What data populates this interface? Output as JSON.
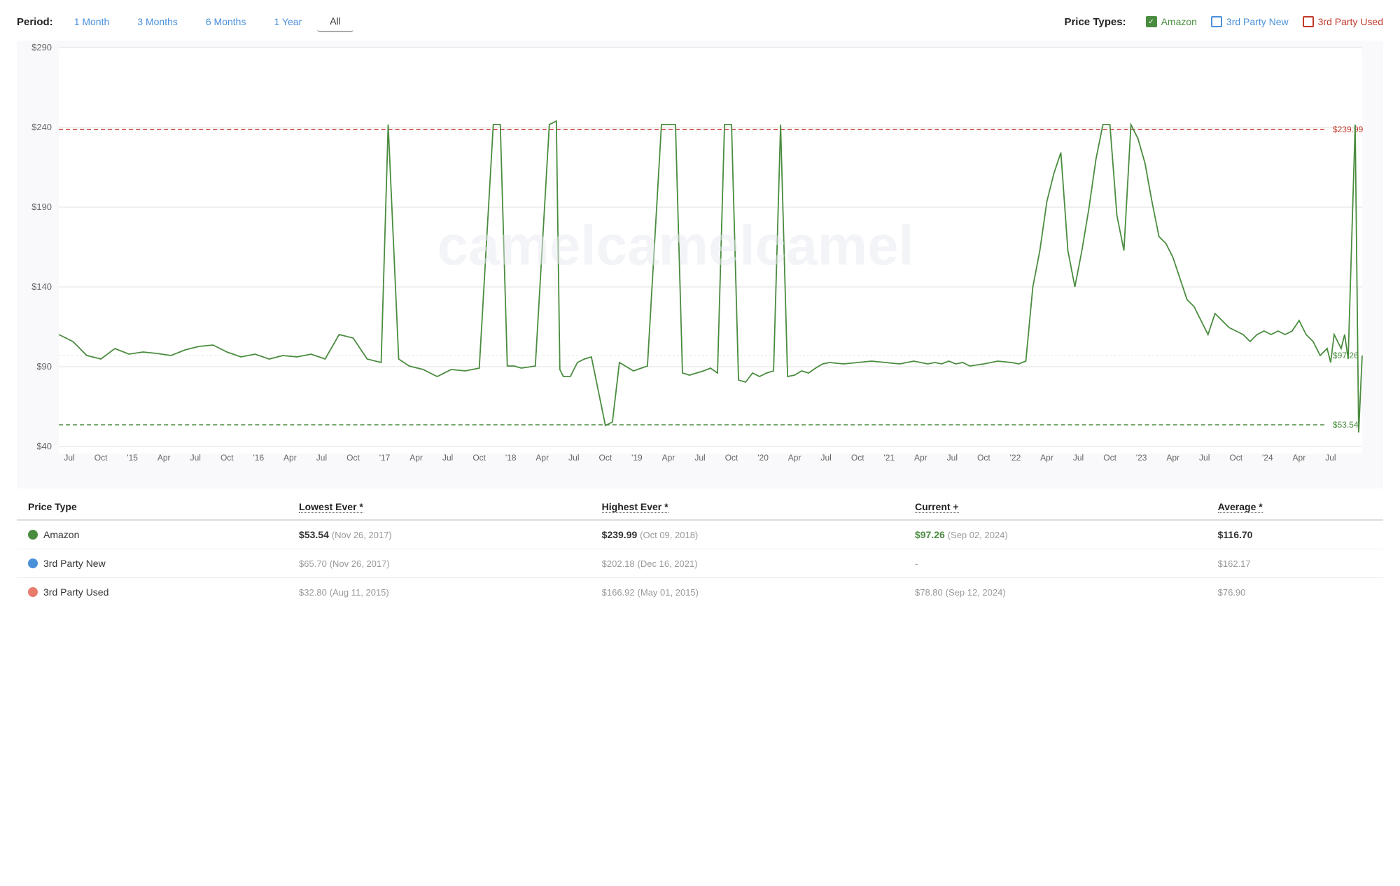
{
  "header": {
    "period_label": "Period:",
    "periods": [
      {
        "label": "1 Month",
        "active": false
      },
      {
        "label": "3 Months",
        "active": false
      },
      {
        "label": "6 Months",
        "active": false
      },
      {
        "label": "1 Year",
        "active": false
      },
      {
        "label": "All",
        "active": true
      }
    ],
    "price_types_label": "Price Types:",
    "price_types": [
      {
        "label": "Amazon",
        "type": "amazon"
      },
      {
        "label": "3rd Party New",
        "type": "new"
      },
      {
        "label": "3rd Party Used",
        "type": "used"
      }
    ]
  },
  "chart": {
    "y_labels": [
      "$290",
      "$240",
      "$190",
      "$140",
      "$90",
      "$40"
    ],
    "x_labels": [
      "Jul",
      "Oct",
      "'15",
      "Apr",
      "Jul",
      "Oct",
      "'16",
      "Apr",
      "Jul",
      "Oct",
      "'17",
      "Apr",
      "Jul",
      "Oct",
      "'18",
      "Apr",
      "Jul",
      "Oct",
      "'19",
      "Apr",
      "Jul",
      "Oct",
      "'20",
      "Apr",
      "Jul",
      "Oct",
      "'21",
      "Apr",
      "Jul",
      "Oct",
      "'22",
      "Apr",
      "Jul",
      "Oct",
      "'23",
      "Apr",
      "Jul",
      "Oct",
      "'24",
      "Apr",
      "Jul"
    ],
    "reference_high": "$239.99",
    "reference_high_color": "#c0392b",
    "reference_low": "$53.54",
    "reference_low_color": "#4a8c3f",
    "current_label": "$97.26",
    "current_color": "#4a8c3f"
  },
  "table": {
    "headers": [
      "Price Type",
      "Lowest Ever *",
      "Highest Ever *",
      "Current +",
      "Average *"
    ],
    "rows": [
      {
        "type": "amazon",
        "name": "Amazon",
        "lowest": "$53.54",
        "lowest_date": "(Nov 26, 2017)",
        "highest": "$239.99",
        "highest_date": "(Oct 09, 2018)",
        "current": "$97.26",
        "current_date": "(Sep 02, 2024)",
        "average": "$116.70"
      },
      {
        "type": "new",
        "name": "3rd Party New",
        "lowest": "$65.70",
        "lowest_date": "(Nov 26, 2017)",
        "highest": "$202.18",
        "highest_date": "(Dec 16, 2021)",
        "current": "-",
        "current_date": "",
        "average": "$162.17"
      },
      {
        "type": "used",
        "name": "3rd Party Used",
        "lowest": "$32.80",
        "lowest_date": "(Aug 11, 2015)",
        "highest": "$166.92",
        "highest_date": "(May 01, 2015)",
        "current": "$78.80",
        "current_date": "(Sep 12, 2024)",
        "average": "$76.90"
      }
    ]
  }
}
